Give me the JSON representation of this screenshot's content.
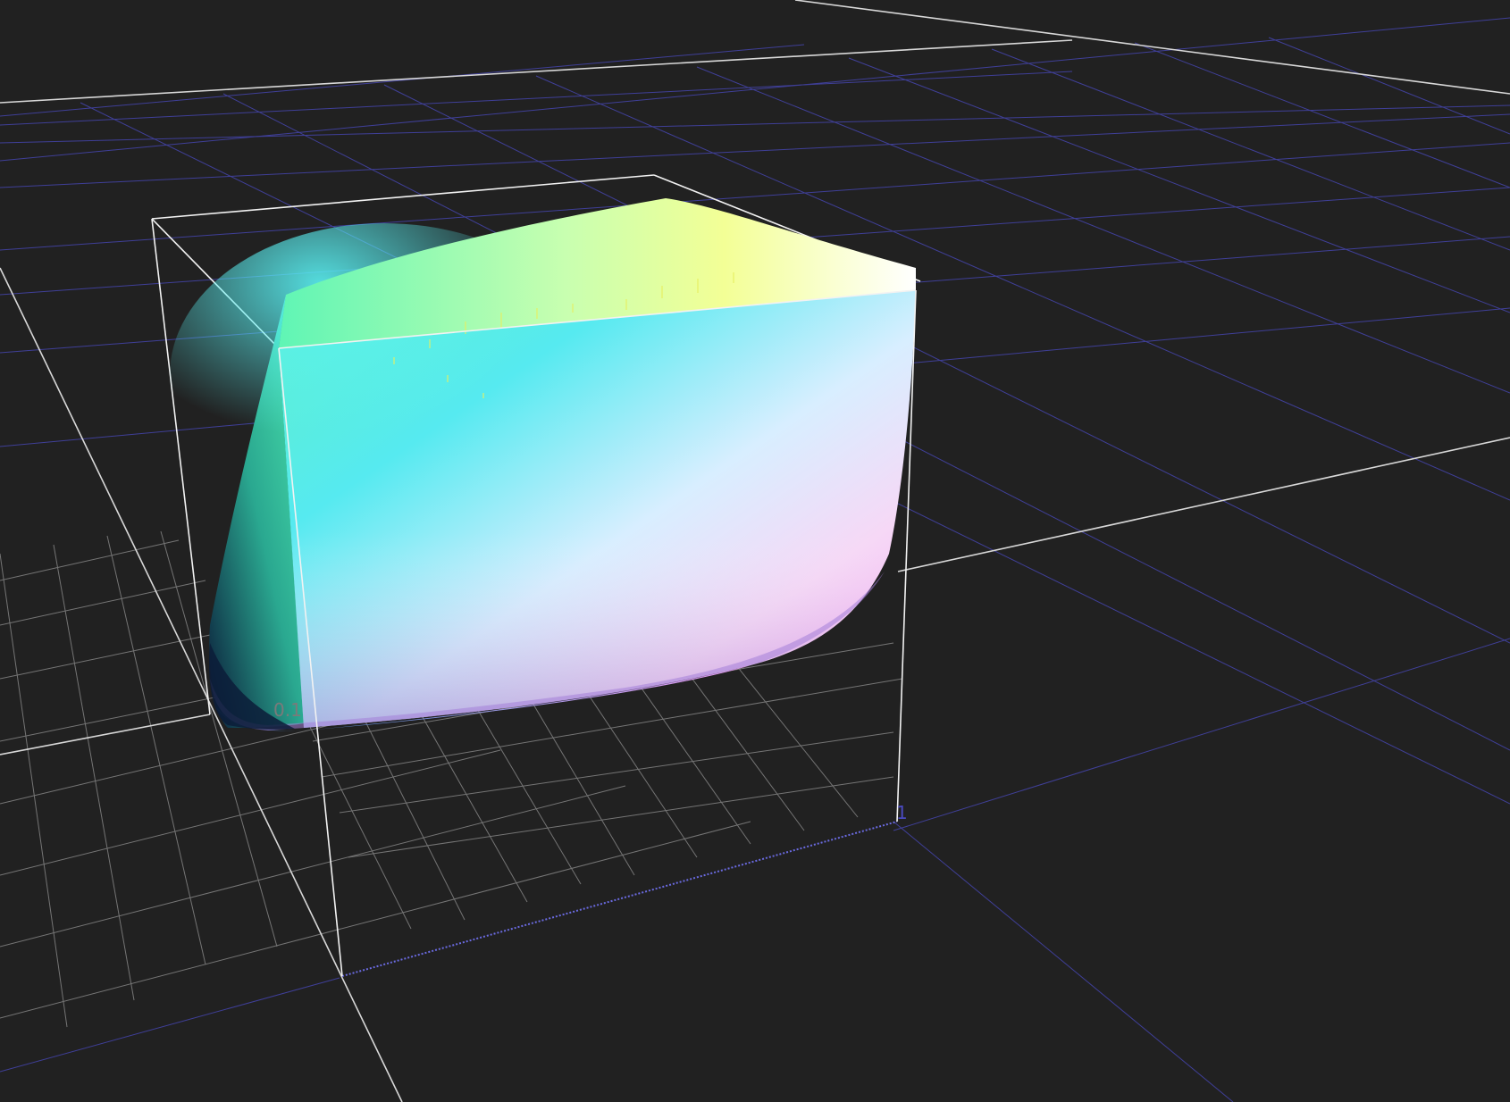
{
  "view": {
    "background": "#212121",
    "grid_color_primary": "#4a4ac0",
    "grid_color_secondary": "#8a8a8a",
    "axis_color": "#d8d8d8",
    "box_color": "#f2f2f2"
  },
  "labels": {
    "near_tick": "0.1",
    "far_tick": "1"
  },
  "gamut": {
    "colors": {
      "top": "#f5ff9c",
      "cyan": "#56eef0",
      "white": "#ffffff",
      "magenta": "#f49af0",
      "blue": "#9b8fe0",
      "dark": "#0c1c38",
      "green": "#5ef0b8"
    }
  }
}
